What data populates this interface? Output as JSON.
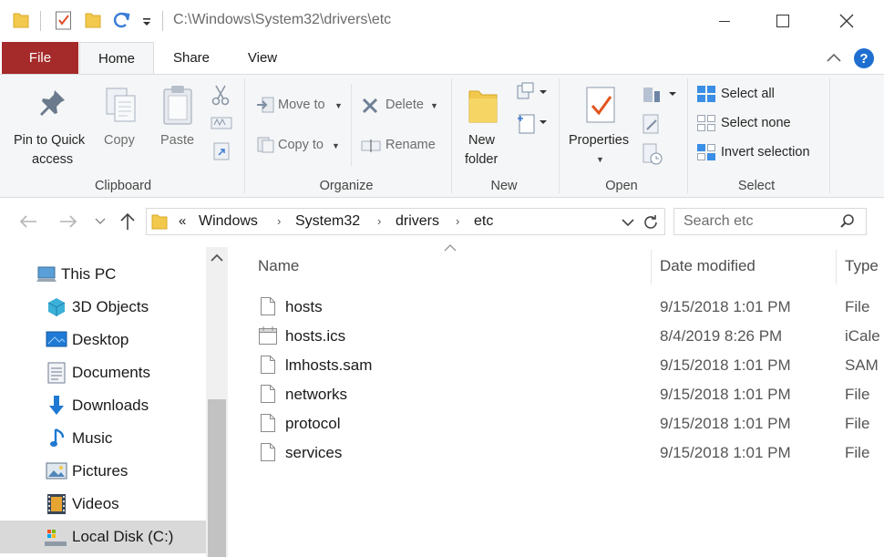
{
  "window": {
    "title": "C:\\Windows\\System32\\drivers\\etc"
  },
  "tabs": {
    "file": "File",
    "home": "Home",
    "share": "Share",
    "view": "View"
  },
  "ribbon": {
    "clipboard": {
      "pin_line1": "Pin to Quick",
      "pin_line2": "access",
      "copy": "Copy",
      "paste": "Paste",
      "label": "Clipboard"
    },
    "organize": {
      "move_to": "Move to",
      "copy_to": "Copy to",
      "delete": "Delete",
      "rename": "Rename",
      "label": "Organize"
    },
    "new": {
      "new_folder_line1": "New",
      "new_folder_line2": "folder",
      "label": "New"
    },
    "open": {
      "properties": "Properties",
      "label": "Open"
    },
    "select": {
      "select_all": "Select all",
      "select_none": "Select none",
      "invert_selection": "Invert selection",
      "label": "Select"
    }
  },
  "address": {
    "overflow": "«",
    "crumbs": [
      "Windows",
      "System32",
      "drivers",
      "etc"
    ],
    "search_placeholder": "Search etc"
  },
  "nav": {
    "items": [
      {
        "label": "This PC",
        "icon": "this-pc-icon"
      },
      {
        "label": "3D Objects",
        "icon": "3d-objects-icon"
      },
      {
        "label": "Desktop",
        "icon": "desktop-icon"
      },
      {
        "label": "Documents",
        "icon": "documents-icon"
      },
      {
        "label": "Downloads",
        "icon": "downloads-icon"
      },
      {
        "label": "Music",
        "icon": "music-icon"
      },
      {
        "label": "Pictures",
        "icon": "pictures-icon"
      },
      {
        "label": "Videos",
        "icon": "videos-icon"
      },
      {
        "label": "Local Disk (C:)",
        "icon": "local-disk-icon"
      }
    ]
  },
  "files": {
    "columns": {
      "name": "Name",
      "date": "Date modified",
      "type": "Type"
    },
    "rows": [
      {
        "name": "hosts",
        "date": "9/15/2018 1:01 PM",
        "type": "File"
      },
      {
        "name": "hosts.ics",
        "date": "8/4/2019 8:26 PM",
        "type": "iCale"
      },
      {
        "name": "lmhosts.sam",
        "date": "9/15/2018 1:01 PM",
        "type": "SAM"
      },
      {
        "name": "networks",
        "date": "9/15/2018 1:01 PM",
        "type": "File"
      },
      {
        "name": "protocol",
        "date": "9/15/2018 1:01 PM",
        "type": "File"
      },
      {
        "name": "services",
        "date": "9/15/2018 1:01 PM",
        "type": "File"
      }
    ]
  },
  "colors": {
    "file_tab": "#a52a2a",
    "accent_blue": "#1e6fd0",
    "folder_yellow": "#f2c94c",
    "ribbon_bg": "#f5f6f7"
  }
}
